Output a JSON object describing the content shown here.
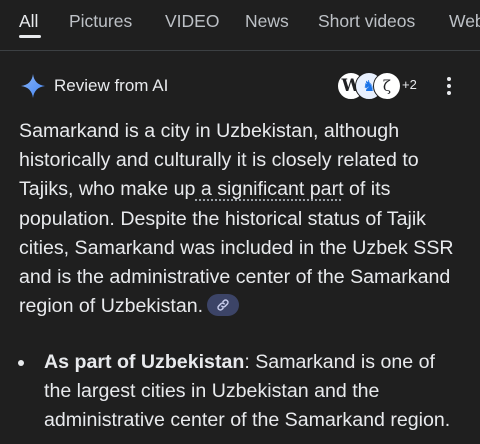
{
  "tabs": [
    {
      "label": "All",
      "active": true
    },
    {
      "label": "Pictures"
    },
    {
      "label": "VIDEO"
    },
    {
      "label": "News"
    },
    {
      "label": "Short videos"
    },
    {
      "label": "Web"
    }
  ],
  "ai_overview": {
    "icon": "gemini-spark-icon",
    "title": "Review from AI",
    "sources": {
      "icons": [
        "W",
        "♞",
        "ζ"
      ],
      "more_label": "+2"
    },
    "menu_icon": "more-vertical-icon"
  },
  "summary": {
    "part1": "Samarkand is a city in Uzbekistan, although historically and culturally it is closely related to Tajiks, who make up",
    "highlight": " a significant part",
    "part2": " of its population. Despite the historical status of Tajik cities, Samarkand was included in the Uzbek SSR and is the administrative center of the Samarkand region of Uzbekistan.",
    "link_chip_icon": "link-icon"
  },
  "bullets": [
    {
      "strong": "As part of Uzbekistan",
      "text": ": Samarkand is one of the largest cities in Uzbekistan and the administrative center of the Samarkand region."
    }
  ],
  "colors": {
    "background": "#1f1f1f",
    "text": "#e8eaed",
    "muted": "#bdc1c6",
    "chip": "#3c4467",
    "spark_blue": "#4285f4"
  }
}
